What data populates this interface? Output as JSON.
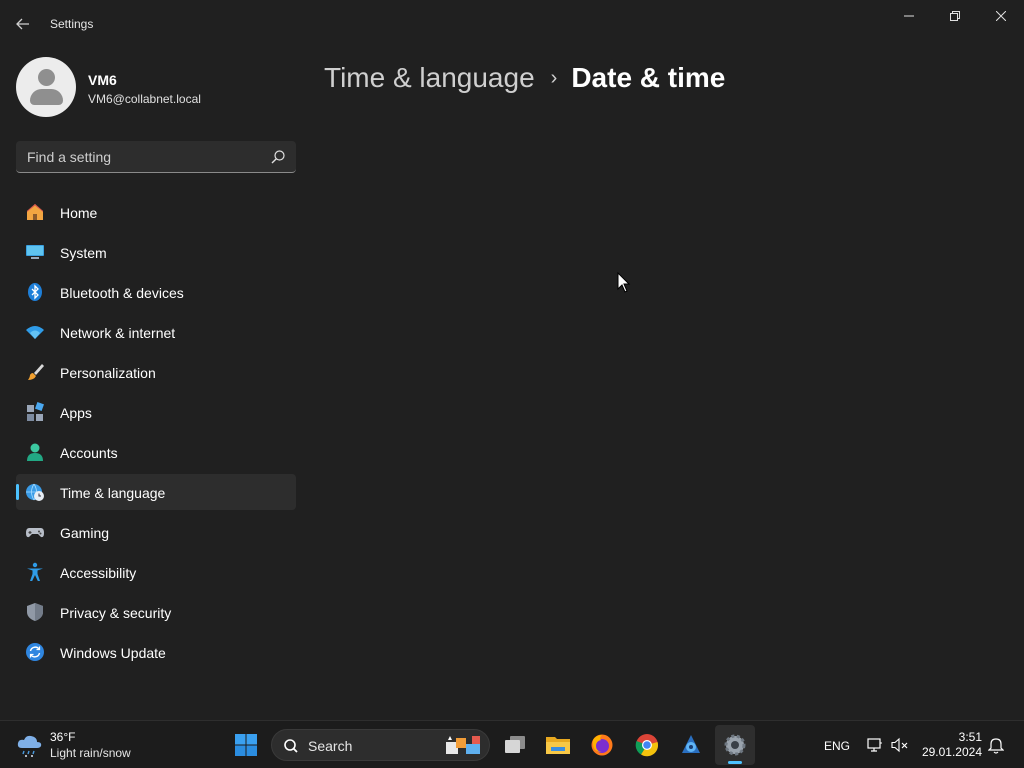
{
  "window": {
    "title": "Settings",
    "back_icon": "back-arrow-icon",
    "controls": [
      "minimize-icon",
      "restore-icon",
      "close-icon"
    ]
  },
  "user": {
    "name": "VM6",
    "email": "VM6@collabnet.local"
  },
  "search": {
    "placeholder": "Find a setting",
    "value": ""
  },
  "nav": {
    "items": [
      {
        "label": "Home",
        "icon": "home-icon"
      },
      {
        "label": "System",
        "icon": "monitor-icon"
      },
      {
        "label": "Bluetooth & devices",
        "icon": "bluetooth-icon"
      },
      {
        "label": "Network & internet",
        "icon": "wifi-icon"
      },
      {
        "label": "Personalization",
        "icon": "brush-icon"
      },
      {
        "label": "Apps",
        "icon": "apps-icon"
      },
      {
        "label": "Accounts",
        "icon": "person-icon"
      },
      {
        "label": "Time & language",
        "icon": "globe-clock-icon",
        "selected": true
      },
      {
        "label": "Gaming",
        "icon": "gamepad-icon"
      },
      {
        "label": "Accessibility",
        "icon": "accessibility-icon"
      },
      {
        "label": "Privacy & security",
        "icon": "shield-icon"
      },
      {
        "label": "Windows Update",
        "icon": "update-icon"
      }
    ]
  },
  "breadcrumb": {
    "parent": "Time & language",
    "separator": "›",
    "current": "Date & time"
  },
  "taskbar": {
    "weather": {
      "temp": "36°F",
      "condition": "Light rain/snow",
      "icon": "rain-snow-cloud-icon"
    },
    "search_label": "Search",
    "apps": [
      "start-icon",
      "task-view-icon",
      "file-explorer-icon",
      "firefox-icon",
      "chrome-icon",
      "app-icon",
      "settings-icon"
    ],
    "active_app": "settings-icon",
    "tray": {
      "language": "ENG",
      "time": "3:51",
      "date": "29.01.2024"
    }
  },
  "colors": {
    "background": "#202020",
    "accent": "#4cc2ff",
    "taskbar": "#1c1c1c"
  }
}
